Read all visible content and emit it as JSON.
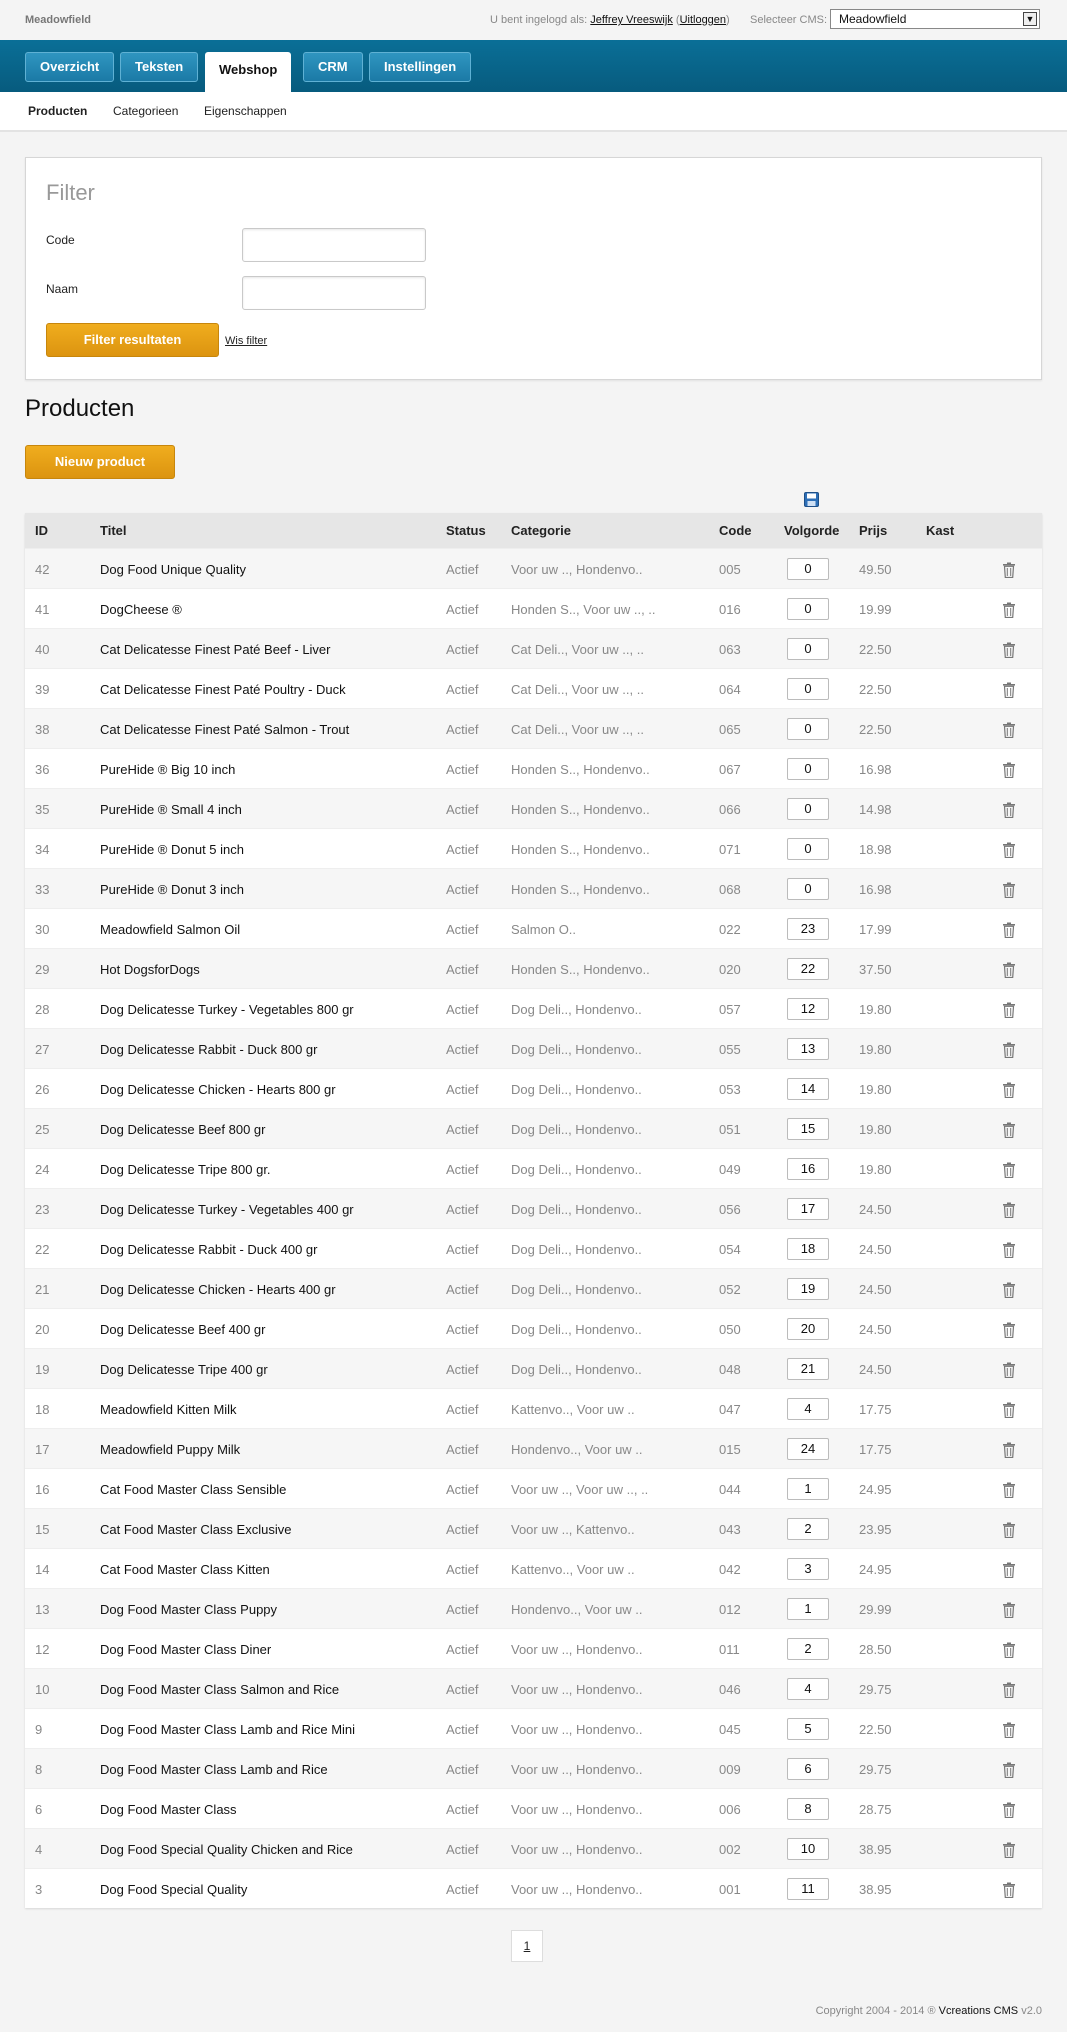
{
  "brand": "Meadowfield",
  "header": {
    "logged_in_prefix": "U bent ingelogd als:",
    "user": "Jeffrey Vreeswijk",
    "logout": "Uitloggen",
    "cms_label": "Selecteer CMS:",
    "cms_value": "Meadowfield"
  },
  "nav": {
    "tabs": [
      "Overzicht",
      "Teksten",
      "Webshop",
      "CRM",
      "Instellingen"
    ],
    "active": "Webshop"
  },
  "subnav": {
    "items": [
      "Producten",
      "Categorieen",
      "Eigenschappen"
    ],
    "active": "Producten"
  },
  "filter": {
    "title": "Filter",
    "code_label": "Code",
    "naam_label": "Naam",
    "code_value": "",
    "naam_value": "",
    "submit": "Filter resultaten",
    "clear": "Wis filter"
  },
  "products": {
    "title": "Producten",
    "new_button": "Nieuw product",
    "columns": [
      "ID",
      "Titel",
      "Status",
      "Categorie",
      "Code",
      "Volgorde",
      "Prijs",
      "Kast"
    ],
    "rows": [
      {
        "id": "42",
        "title": "Dog Food Unique Quality",
        "status": "Actief",
        "category": "Voor uw .., Hondenvo..",
        "code": "005",
        "order": "0",
        "price": "49.50"
      },
      {
        "id": "41",
        "title": "DogCheese ®",
        "status": "Actief",
        "category": "Honden S.., Voor uw .., ..",
        "code": "016",
        "order": "0",
        "price": "19.99"
      },
      {
        "id": "40",
        "title": "Cat Delicatesse Finest Paté Beef - Liver",
        "status": "Actief",
        "category": "Cat Deli.., Voor uw .., ..",
        "code": "063",
        "order": "0",
        "price": "22.50"
      },
      {
        "id": "39",
        "title": "Cat Delicatesse Finest Paté Poultry - Duck",
        "status": "Actief",
        "category": "Cat Deli.., Voor uw .., ..",
        "code": "064",
        "order": "0",
        "price": "22.50"
      },
      {
        "id": "38",
        "title": "Cat Delicatesse Finest Paté Salmon - Trout",
        "status": "Actief",
        "category": "Cat Deli.., Voor uw .., ..",
        "code": "065",
        "order": "0",
        "price": "22.50"
      },
      {
        "id": "36",
        "title": "PureHide ® Big 10 inch",
        "status": "Actief",
        "category": "Honden S.., Hondenvo..",
        "code": "067",
        "order": "0",
        "price": "16.98"
      },
      {
        "id": "35",
        "title": "PureHide ® Small 4 inch",
        "status": "Actief",
        "category": "Honden S.., Hondenvo..",
        "code": "066",
        "order": "0",
        "price": "14.98"
      },
      {
        "id": "34",
        "title": "PureHide ® Donut 5 inch",
        "status": "Actief",
        "category": "Honden S.., Hondenvo..",
        "code": "071",
        "order": "0",
        "price": "18.98"
      },
      {
        "id": "33",
        "title": "PureHide ® Donut 3 inch",
        "status": "Actief",
        "category": "Honden S.., Hondenvo..",
        "code": "068",
        "order": "0",
        "price": "16.98"
      },
      {
        "id": "30",
        "title": "Meadowfield Salmon Oil",
        "status": "Actief",
        "category": "Salmon O..",
        "code": "022",
        "order": "23",
        "price": "17.99"
      },
      {
        "id": "29",
        "title": "Hot DogsforDogs",
        "status": "Actief",
        "category": "Honden S.., Hondenvo..",
        "code": "020",
        "order": "22",
        "price": "37.50"
      },
      {
        "id": "28",
        "title": "Dog Delicatesse Turkey - Vegetables 800 gr",
        "status": "Actief",
        "category": "Dog Deli.., Hondenvo..",
        "code": "057",
        "order": "12",
        "price": "19.80"
      },
      {
        "id": "27",
        "title": "Dog Delicatesse Rabbit - Duck 800 gr",
        "status": "Actief",
        "category": "Dog Deli.., Hondenvo..",
        "code": "055",
        "order": "13",
        "price": "19.80"
      },
      {
        "id": "26",
        "title": "Dog Delicatesse Chicken - Hearts 800 gr",
        "status": "Actief",
        "category": "Dog Deli.., Hondenvo..",
        "code": "053",
        "order": "14",
        "price": "19.80"
      },
      {
        "id": "25",
        "title": "Dog Delicatesse Beef 800 gr",
        "status": "Actief",
        "category": "Dog Deli.., Hondenvo..",
        "code": "051",
        "order": "15",
        "price": "19.80"
      },
      {
        "id": "24",
        "title": "Dog Delicatesse Tripe 800 gr.",
        "status": "Actief",
        "category": "Dog Deli.., Hondenvo..",
        "code": "049",
        "order": "16",
        "price": "19.80"
      },
      {
        "id": "23",
        "title": "Dog Delicatesse Turkey - Vegetables 400 gr",
        "status": "Actief",
        "category": "Dog Deli.., Hondenvo..",
        "code": "056",
        "order": "17",
        "price": "24.50"
      },
      {
        "id": "22",
        "title": "Dog Delicatesse Rabbit - Duck 400 gr",
        "status": "Actief",
        "category": "Dog Deli.., Hondenvo..",
        "code": "054",
        "order": "18",
        "price": "24.50"
      },
      {
        "id": "21",
        "title": "Dog Delicatesse Chicken - Hearts 400 gr",
        "status": "Actief",
        "category": "Dog Deli.., Hondenvo..",
        "code": "052",
        "order": "19",
        "price": "24.50"
      },
      {
        "id": "20",
        "title": "Dog Delicatesse Beef 400 gr",
        "status": "Actief",
        "category": "Dog Deli.., Hondenvo..",
        "code": "050",
        "order": "20",
        "price": "24.50"
      },
      {
        "id": "19",
        "title": "Dog Delicatesse Tripe 400 gr",
        "status": "Actief",
        "category": "Dog Deli.., Hondenvo..",
        "code": "048",
        "order": "21",
        "price": "24.50"
      },
      {
        "id": "18",
        "title": "Meadowfield Kitten Milk",
        "status": "Actief",
        "category": "Kattenvo.., Voor uw ..",
        "code": "047",
        "order": "4",
        "price": "17.75"
      },
      {
        "id": "17",
        "title": "Meadowfield Puppy Milk",
        "status": "Actief",
        "category": "Hondenvo.., Voor uw ..",
        "code": "015",
        "order": "24",
        "price": "17.75"
      },
      {
        "id": "16",
        "title": "Cat Food Master Class Sensible",
        "status": "Actief",
        "category": "Voor uw .., Voor uw .., ..",
        "code": "044",
        "order": "1",
        "price": "24.95"
      },
      {
        "id": "15",
        "title": "Cat Food Master Class Exclusive",
        "status": "Actief",
        "category": "Voor uw .., Kattenvo..",
        "code": "043",
        "order": "2",
        "price": "23.95"
      },
      {
        "id": "14",
        "title": "Cat Food Master Class Kitten",
        "status": "Actief",
        "category": "Kattenvo.., Voor uw ..",
        "code": "042",
        "order": "3",
        "price": "24.95"
      },
      {
        "id": "13",
        "title": "Dog Food Master Class Puppy",
        "status": "Actief",
        "category": "Hondenvo.., Voor uw ..",
        "code": "012",
        "order": "1",
        "price": "29.99"
      },
      {
        "id": "12",
        "title": "Dog Food Master Class Diner",
        "status": "Actief",
        "category": "Voor uw .., Hondenvo..",
        "code": "011",
        "order": "2",
        "price": "28.50"
      },
      {
        "id": "10",
        "title": "Dog Food Master Class Salmon and Rice",
        "status": "Actief",
        "category": "Voor uw .., Hondenvo..",
        "code": "046",
        "order": "4",
        "price": "29.75"
      },
      {
        "id": "9",
        "title": "Dog Food Master Class Lamb and Rice Mini",
        "status": "Actief",
        "category": "Voor uw .., Hondenvo..",
        "code": "045",
        "order": "5",
        "price": "22.50"
      },
      {
        "id": "8",
        "title": "Dog Food Master Class Lamb and Rice",
        "status": "Actief",
        "category": "Voor uw .., Hondenvo..",
        "code": "009",
        "order": "6",
        "price": "29.75"
      },
      {
        "id": "6",
        "title": "Dog Food Master Class",
        "status": "Actief",
        "category": "Voor uw .., Hondenvo..",
        "code": "006",
        "order": "8",
        "price": "28.75"
      },
      {
        "id": "4",
        "title": "Dog Food Special Quality Chicken and Rice",
        "status": "Actief",
        "category": "Voor uw .., Hondenvo..",
        "code": "002",
        "order": "10",
        "price": "38.95"
      },
      {
        "id": "3",
        "title": "Dog Food Special Quality",
        "status": "Actief",
        "category": "Voor uw .., Hondenvo..",
        "code": "001",
        "order": "11",
        "price": "38.95"
      }
    ]
  },
  "pagination": {
    "current": "1"
  },
  "footer": {
    "copyright": "Copyright 2004 - 2014 ®",
    "product": "Vcreations CMS",
    "version": "v2.0"
  },
  "icons": {
    "save": "save-icon",
    "delete": "trash-icon"
  },
  "colors": {
    "nav": "#0a6f97",
    "accent": "#e09a14"
  }
}
